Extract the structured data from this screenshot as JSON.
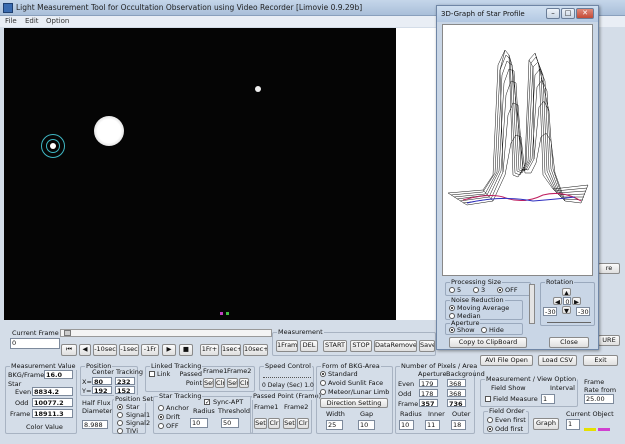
{
  "window": {
    "title": "Light Measurement Tool for Occultation Observation using Video Recorder [Limovie 0.9.29b]"
  },
  "menu": [
    "File",
    "Edit",
    "Option"
  ],
  "popup": {
    "title": "3D-Graph of Star Profile",
    "processing_size": {
      "label": "Processing Size",
      "options": [
        "5",
        "3",
        "OFF"
      ],
      "selected": "OFF"
    },
    "noise_reduction": {
      "label": "Noise Reduction",
      "options": [
        "Moving Average",
        "Median"
      ],
      "selected": "Moving Average"
    },
    "aperture": {
      "label": "Aperture",
      "options": [
        "Show",
        "Hide"
      ],
      "selected": "Show"
    },
    "rotation": {
      "label": "Rotation",
      "center": "0",
      "left": "-30",
      "right": "-30"
    },
    "copy_button": "Copy to ClipBoard",
    "close_button": "Close"
  },
  "current_frame": {
    "label": "Current Frame",
    "value": "0"
  },
  "playback": [
    "⏮",
    "◀",
    "-10sec",
    "-1sec",
    "-1Fr",
    "▶",
    "■",
    "1Fr+",
    "1sec+",
    "10sec+"
  ],
  "measurement_buttons": {
    "label": "Measurement",
    "frame1": "1Frame",
    "del": "DEL",
    "start": "START",
    "stop": "STOP",
    "data_remove": "DataRemove",
    "save": "Save"
  },
  "right_buttons": {
    "avi_open": "AVI File Open",
    "load_csv": "Load CSV",
    "exit": "Exit",
    "ure": "URE",
    "re": "re"
  },
  "measurement_value": {
    "label": "Measurement Value",
    "bkg_label": "BKG/Frame",
    "bkg": "16.0",
    "star_label": "Star",
    "even_label": "Even",
    "even": "8834.2",
    "odd_label": "Odd",
    "odd": "10077.2",
    "frame_label": "Frame",
    "frame": "18911.3",
    "color_value": "Color Value"
  },
  "position": {
    "label": "Position",
    "center_tracking": "Center Tracking",
    "x_label": "X=",
    "x1": "80",
    "x2": "232",
    "y_label": "Y=",
    "y1": "192",
    "y2": "152"
  },
  "half_flux": {
    "label": "Half Flux Diameter",
    "value": "8.988"
  },
  "position_set": {
    "label": "Position Set",
    "options": [
      "Star",
      "Signal1",
      "Signal2",
      "TIVi"
    ],
    "selected": "Star"
  },
  "linked_tracking": {
    "label": "Linked Tracking",
    "link": "Link",
    "passed_point": "Passed Point",
    "frame1": "Frame1",
    "frame2": "Frame2",
    "set": "Set",
    "clr": "Clr"
  },
  "star_tracking": {
    "label": "Star Tracking",
    "anchor": "Anchor",
    "drift": "Drift",
    "off": "OFF",
    "selected": "Drift",
    "sync_apt": "Sync-APT",
    "radius_label": "Radius",
    "radius": "10",
    "threshold_label": "Threshold",
    "threshold": "50"
  },
  "speed_control": {
    "label": "Speed Control",
    "delay": "0  Delay (Sec) 1.0"
  },
  "passed_point": {
    "label": "Passed Point (Frame)",
    "frame1": "Frame1",
    "frame2": "Frame2",
    "set": "Set",
    "clr": "Clr"
  },
  "bkg_area": {
    "label": "Form of BKG-Area",
    "options": [
      "Standard",
      "Avoid Sunlit Face",
      "Meteor/Lunar Limb"
    ],
    "selected": "Standard",
    "direction": "Direction Setting",
    "width_label": "Width",
    "width": "25",
    "gap_label": "Gap",
    "gap": "10"
  },
  "pixels": {
    "label": "Number of Pixels / Area",
    "aperture": "Aperture",
    "background": "Background",
    "even_label": "Even",
    "odd_label": "Odd",
    "frame_label": "Frame",
    "ap_even": "179",
    "bg_even": "368",
    "ap_odd": "178",
    "bg_odd": "368",
    "ap_frame": "357",
    "bg_frame": "736",
    "radius_label": "Radius",
    "inner_label": "Inner",
    "outer_label": "Outer",
    "radius": "10",
    "inner": "11",
    "outer": "18"
  },
  "view_option": {
    "label": "Measurement / View Option",
    "field_show": "Field Show",
    "interval_label": "Interval",
    "interval": "1",
    "field_measure": "Field Measure"
  },
  "frame_rate": {
    "label": "Frame Rate from VFW",
    "value": "25.00"
  },
  "field_order": {
    "label": "Field Order",
    "options": [
      "Even first",
      "Odd first"
    ],
    "selected": "Odd first"
  },
  "graph_button": "Graph",
  "current_object": {
    "label": "Current Object",
    "value": "1"
  }
}
